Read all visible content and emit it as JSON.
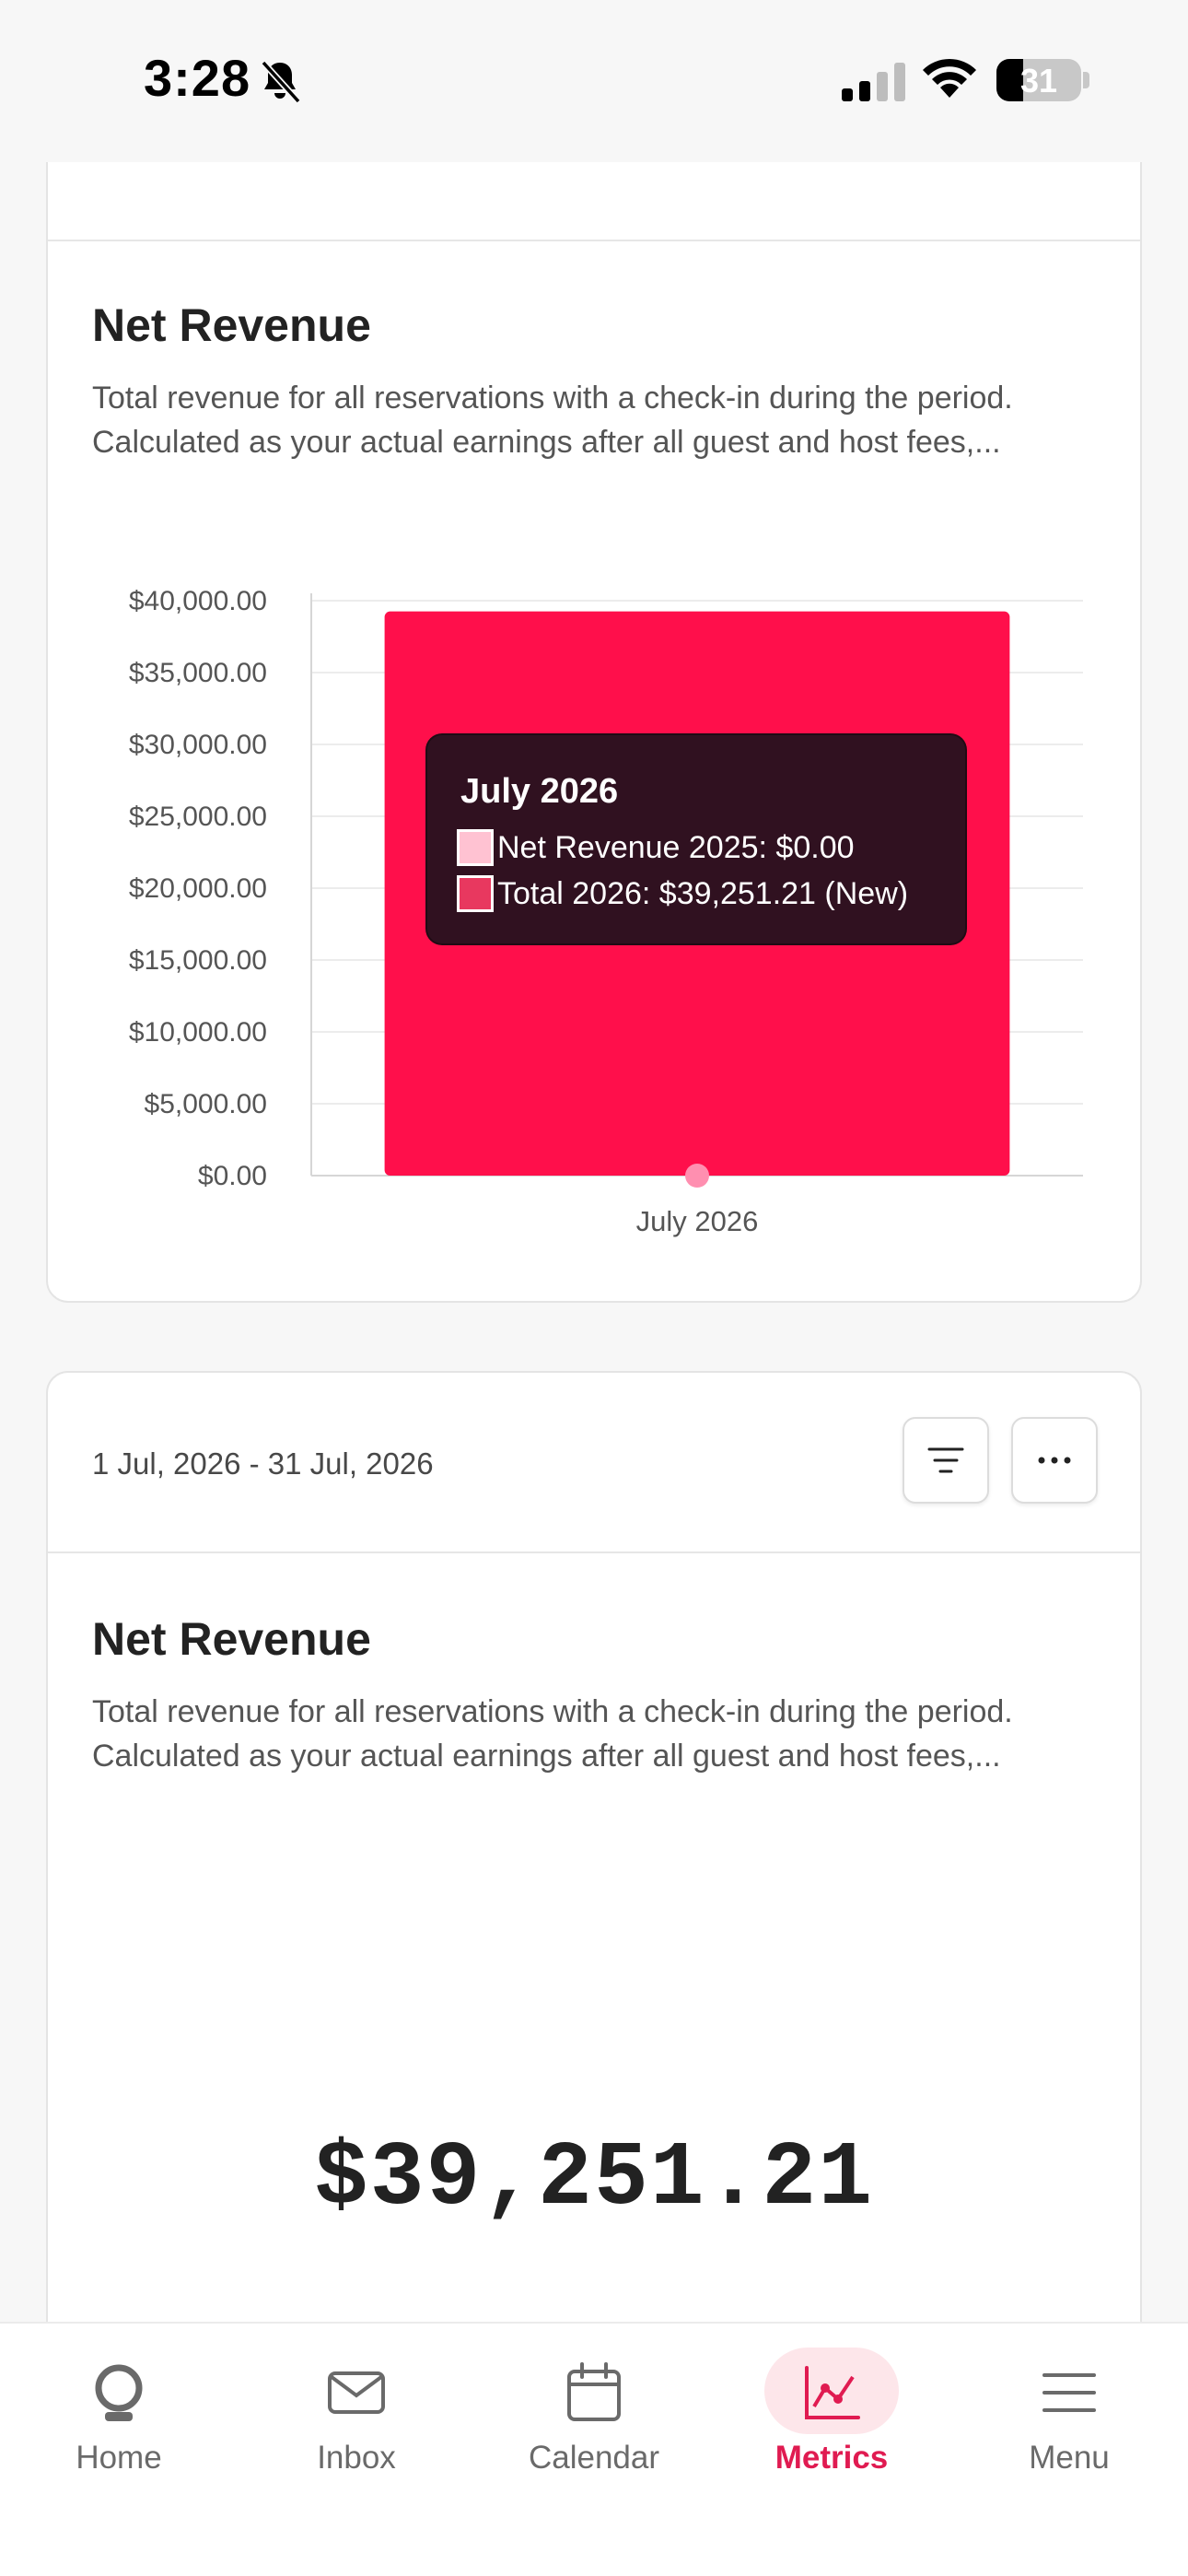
{
  "status_bar": {
    "time": "3:28",
    "battery_percent": 31,
    "battery_label": "31",
    "icons": [
      "bell-slash-icon",
      "signal-icon",
      "wifi-icon",
      "battery-icon"
    ]
  },
  "card_top": {
    "title": "Net Revenue",
    "description_line1": "Total revenue for all reservations with a check-in during the period.",
    "description_line2": "Calculated as your actual earnings after all guest and host fees,..."
  },
  "chart_data": {
    "type": "bar",
    "categories": [
      "July 2026"
    ],
    "series": [
      {
        "name": "Net Revenue 2025",
        "values": [
          0.0
        ],
        "color": "#ff8fb0",
        "display": "point"
      },
      {
        "name": "Total 2026",
        "values": [
          39251.21
        ],
        "color": "#ff0f4b",
        "display": "bar"
      }
    ],
    "y_ticks": [
      "$0.00",
      "$5,000.00",
      "$10,000.00",
      "$15,000.00",
      "$20,000.00",
      "$25,000.00",
      "$30,000.00",
      "$35,000.00",
      "$40,000.00"
    ],
    "ylim": [
      0,
      40000
    ],
    "grid": true,
    "title": "",
    "xlabel": "",
    "ylabel": ""
  },
  "tooltip": {
    "title": "July 2026",
    "row1": "Net Revenue 2025: $0.00",
    "row2": "Total 2026: $39,251.21 (New)",
    "row1_color": "#ffc2d2",
    "row2_color": "#e8385f"
  },
  "card_bottom": {
    "date_range": "1 Jul, 2026 - 31 Jul, 2026",
    "title": "Net Revenue",
    "description_line1": "Total revenue for all reservations with a check-in during the period.",
    "description_line2": "Calculated as your actual earnings after all guest and host fees,...",
    "value": "$39,251.21"
  },
  "bottom_nav": {
    "items": [
      {
        "label": "Home",
        "icon": "home-icon",
        "active": false
      },
      {
        "label": "Inbox",
        "icon": "inbox-icon",
        "active": false
      },
      {
        "label": "Calendar",
        "icon": "calendar-icon",
        "active": false
      },
      {
        "label": "Metrics",
        "icon": "metrics-icon",
        "active": true
      },
      {
        "label": "Menu",
        "icon": "menu-icon",
        "active": false
      }
    ]
  },
  "colors": {
    "accent": "#e01b51",
    "bar": "#ff0f4b",
    "point": "#ff8fb0"
  }
}
